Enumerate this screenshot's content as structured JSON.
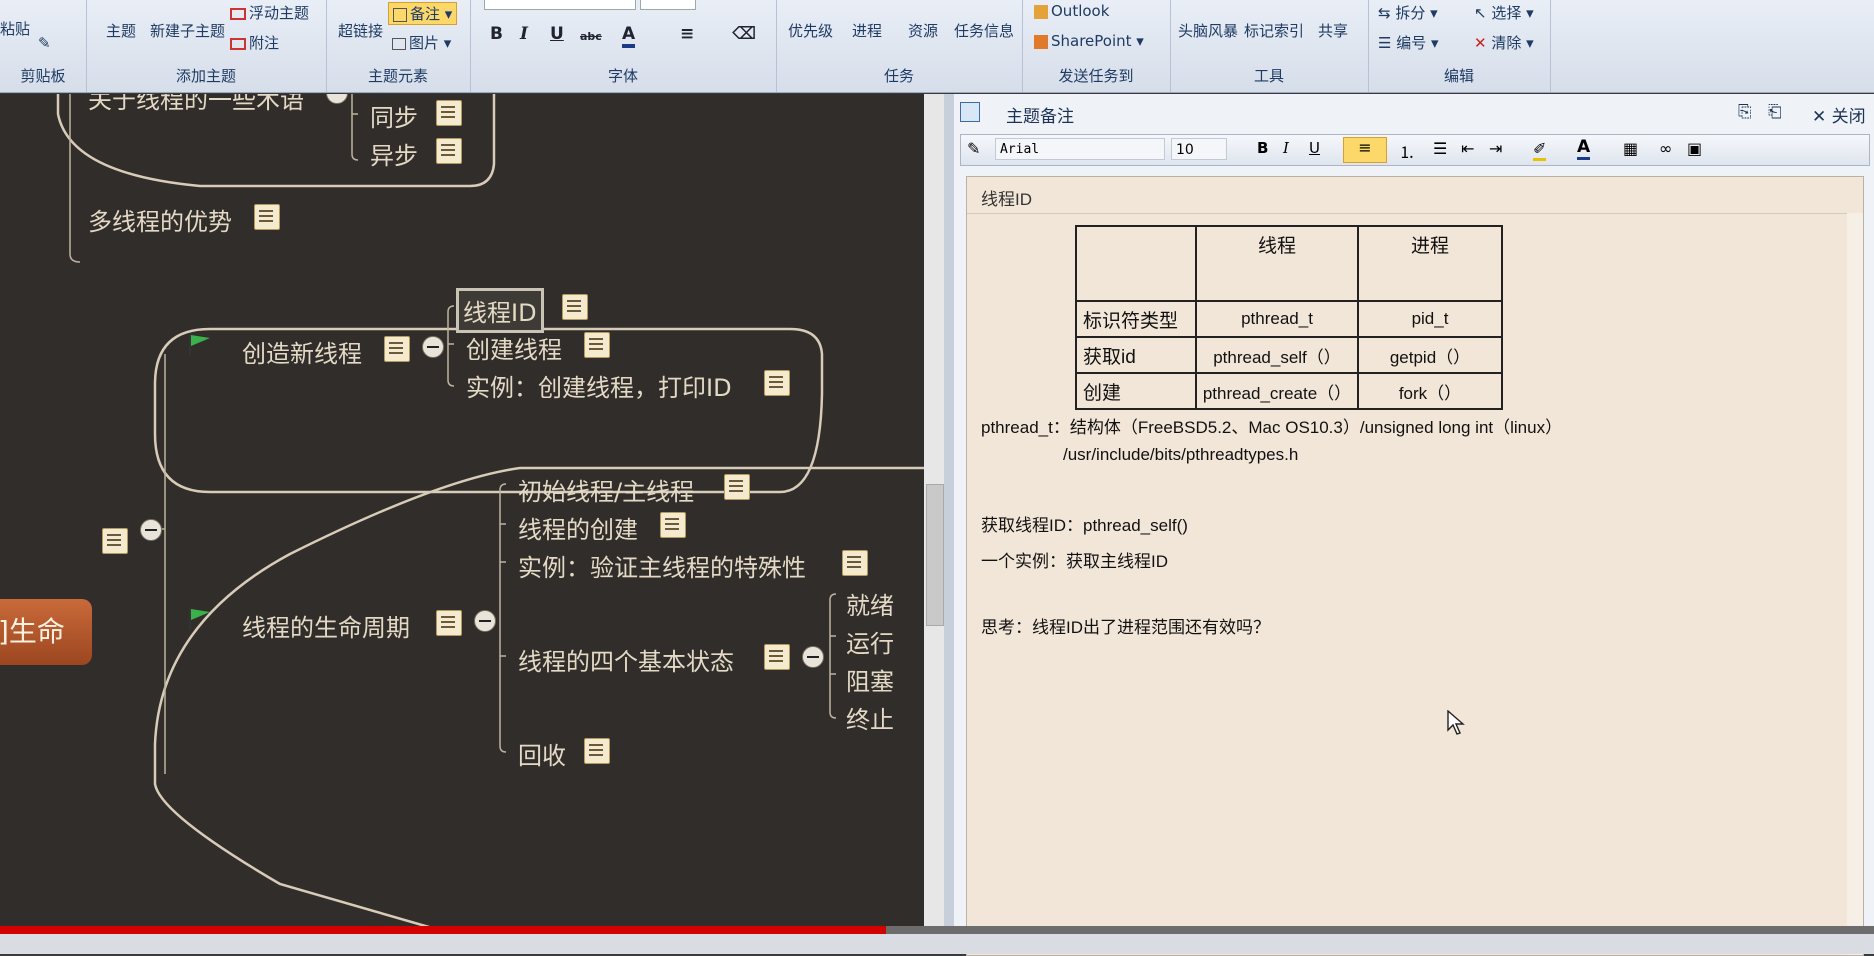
{
  "ribbon": {
    "clipboard": {
      "paste": "粘贴",
      "label": "剪贴板"
    },
    "add_topic": {
      "topic": "主题",
      "subtopic": "新建子主题",
      "floating": "浮动主题",
      "callout": "附注",
      "label": "添加主题"
    },
    "topic_elements": {
      "hyperlink": "超链接",
      "notes": "备注",
      "picture": "图片",
      "label": "主题元素"
    },
    "font": {
      "bold": "B",
      "italic": "I",
      "underline": "U",
      "strike": "abc",
      "color": "A",
      "label": "字体"
    },
    "task": {
      "priority": "优先级",
      "progress": "进程",
      "resources": "资源",
      "task_info": "任务信息",
      "label": "任务"
    },
    "send_task": {
      "outlook": "Outlook",
      "sharepoint": "SharePoint",
      "label": "发送任务到"
    },
    "tools": {
      "brainstorm": "头脑风暴",
      "index": "标记索引",
      "share": "共享",
      "label": "工具"
    },
    "edit": {
      "split": "拆分",
      "numbering": "编号",
      "select": "选择",
      "clear": "清除",
      "label": "编辑"
    }
  },
  "mindmap": {
    "terms_node": "关于线程的一些术语",
    "sync": "同步",
    "async": "异步",
    "advantages": "多线程的优势",
    "create_thread_group": "创造新线程",
    "thread_id": "线程ID",
    "create_thread": "创建线程",
    "example_create": "实例：创建线程，打印ID",
    "root": "]生命",
    "lifecycle_group": "线程的生命周期",
    "main_thread": "初始线程/主线程",
    "thread_creation": "线程的创建",
    "example_verify": "实例：验证主线程的特殊性",
    "four_states": "线程的四个基本状态",
    "ready": "就绪",
    "running": "运行",
    "blocked": "阻塞",
    "terminated": "终止",
    "reclaim": "回收"
  },
  "notes_panel": {
    "title": "主题备注",
    "close": "关闭",
    "font_name": "Arial",
    "font_size": "10",
    "doc_title": "线程ID",
    "table": {
      "headers": [
        "",
        "线程",
        "进程"
      ],
      "rows": [
        [
          "标识符类型",
          "pthread_t",
          "pid_t"
        ],
        [
          "获取id",
          "pthread_self（）",
          "getpid（）"
        ],
        [
          "创建",
          "pthread_create（）",
          "fork（）"
        ]
      ]
    },
    "lines": {
      "l1": "pthread_t：结构体（FreeBSD5.2、Mac OS10.3）/unsigned long int（linux）",
      "l2": "/usr/include/bits/pthreadtypes.h",
      "l3": "获取线程ID：pthread_self()",
      "l4": "一个实例：获取主线程ID",
      "l5": "思考：线程ID出了进程范围还有效吗？"
    }
  },
  "video_progress_percent": 47.3,
  "colors": {
    "accent_orange": "#b5542a",
    "progress_red": "#d40000",
    "canvas_bg": "#302d2b",
    "doc_bg": "#f2e6d8"
  }
}
